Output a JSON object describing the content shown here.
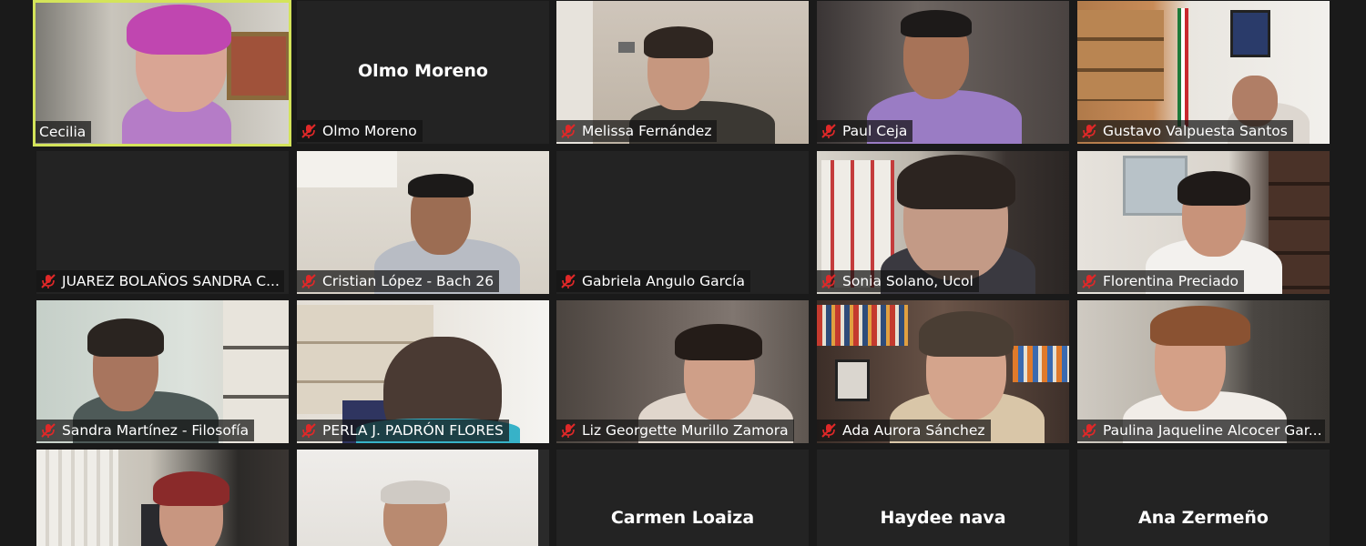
{
  "participants": [
    {
      "name": "Cecilia",
      "muted": false,
      "video": true,
      "active": true
    },
    {
      "name": "Olmo Moreno",
      "muted": true,
      "video": false
    },
    {
      "name": "Melissa Fernández",
      "muted": true,
      "video": true
    },
    {
      "name": "Paul Ceja",
      "muted": true,
      "video": true
    },
    {
      "name": "Gustavo Valpuesta Santos",
      "muted": true,
      "video": true
    },
    {
      "name": "JUAREZ BOLAÑOS SANDRA C...",
      "muted": true,
      "video": false
    },
    {
      "name": "Cristian López - Bach 26",
      "muted": true,
      "video": true
    },
    {
      "name": "Gabriela Angulo García",
      "muted": true,
      "video": false
    },
    {
      "name": "Sonia Solano, Ucol",
      "muted": true,
      "video": true
    },
    {
      "name": "Florentina Preciado",
      "muted": true,
      "video": true
    },
    {
      "name": "Sandra Martínez - Filosofía",
      "muted": true,
      "video": true
    },
    {
      "name": "PERLA J. PADRÓN FLORES",
      "muted": true,
      "video": true
    },
    {
      "name": "Liz Georgette Murillo Zamora",
      "muted": true,
      "video": true
    },
    {
      "name": "Ada Aurora Sánchez",
      "muted": true,
      "video": true
    },
    {
      "name": "Paulina Jaqueline Alcocer Gar...",
      "muted": true,
      "video": true
    },
    {
      "name": "",
      "muted": true,
      "video": true
    },
    {
      "name": "",
      "muted": true,
      "video": true
    },
    {
      "name": "Carmen Loaiza",
      "muted": true,
      "video": false
    },
    {
      "name": "Haydee nava",
      "muted": true,
      "video": false
    },
    {
      "name": "Ana Zermeño",
      "muted": true,
      "video": false
    }
  ],
  "colors": {
    "active_border": "#d4e45a",
    "muted_icon": "#e02828",
    "tile_bg": "#232323",
    "page_bg": "#1a1a1a"
  },
  "icons": {
    "muted": "muted-microphone-icon"
  }
}
